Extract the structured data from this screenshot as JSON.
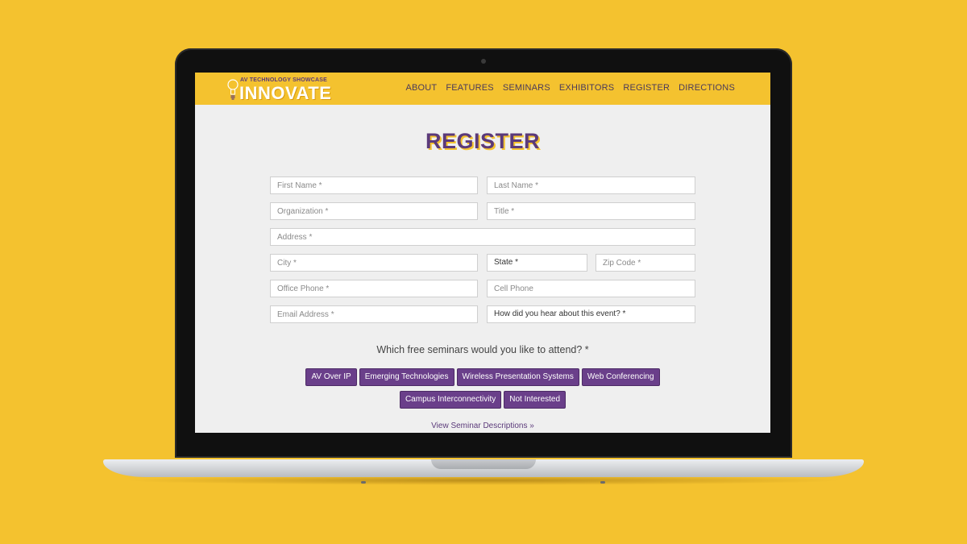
{
  "header": {
    "logo_small": "AV TECHNOLOGY SHOWCASE",
    "logo_big": "INNOVATE",
    "nav": [
      "ABOUT",
      "FEATURES",
      "SEMINARS",
      "EXHIBITORS",
      "REGISTER",
      "DIRECTIONS"
    ]
  },
  "page": {
    "title": "REGISTER"
  },
  "form": {
    "first_name": "First Name *",
    "last_name": "Last Name *",
    "organization": "Organization *",
    "title": "Title *",
    "address": "Address *",
    "city": "City *",
    "state": "State *",
    "zip": "Zip Code *",
    "office_phone": "Office Phone *",
    "cell_phone": "Cell Phone",
    "email": "Email Address *",
    "hear_about": "How did you hear about this event? *"
  },
  "seminars": {
    "question": "Which free seminars would you like to attend? *",
    "options": [
      "AV Over IP",
      "Emerging Technologies",
      "Wireless Presentation Systems",
      "Web Conferencing",
      "Campus Interconnectivity",
      "Not Interested"
    ],
    "link": "View Seminar Descriptions »"
  },
  "colors": {
    "brand_yellow": "#f4c22f",
    "brand_purple": "#6a3f8a"
  }
}
